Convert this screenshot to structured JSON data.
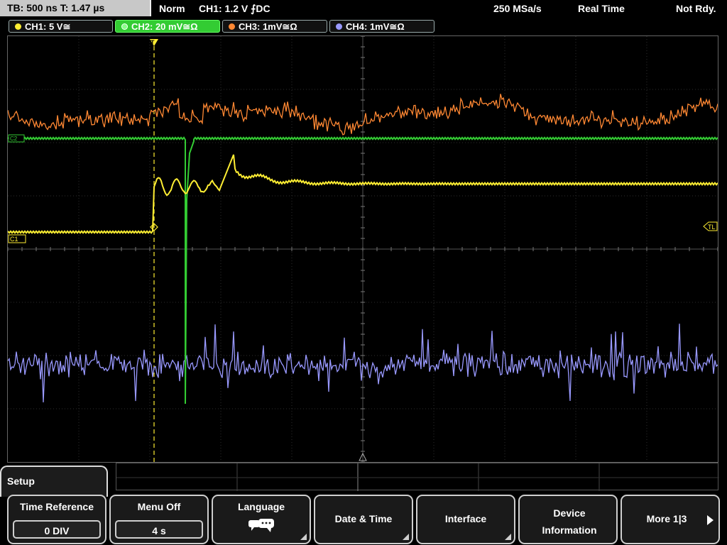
{
  "status": {
    "timebase": "TB: 500 ns   T: 1.47 µs",
    "mode": "Norm",
    "trigger": "CH1: 1.2 V ⨍DC",
    "sample_rate": "250 MSa/s",
    "acq_mode": "Real Time",
    "state": "Not Rdy."
  },
  "channels": [
    {
      "label": "CH1: 5 V≅",
      "color": "#ffee33"
    },
    {
      "label": "CH2: 20 mV≅Ω",
      "color": "#33cc33"
    },
    {
      "label": "CH3: 1mV≅Ω",
      "color": "#ff8833"
    },
    {
      "label": "CH4: 1mV≅Ω",
      "color": "#9999ff"
    }
  ],
  "markers": {
    "c1": "C1",
    "c2": "C2",
    "tl": "TL",
    "trigger_pos": "T"
  },
  "menu": {
    "title": "Setup",
    "softkeys": [
      {
        "label": "Time Reference",
        "value": "0 DIV"
      },
      {
        "label": "Menu Off",
        "value": "4 s"
      },
      {
        "label": "Language",
        "icon": "speech-bubble-icon"
      },
      {
        "label": "Date & Time"
      },
      {
        "label": "Interface"
      },
      {
        "label": "Device Information"
      },
      {
        "label": "More 1|3"
      }
    ]
  }
}
